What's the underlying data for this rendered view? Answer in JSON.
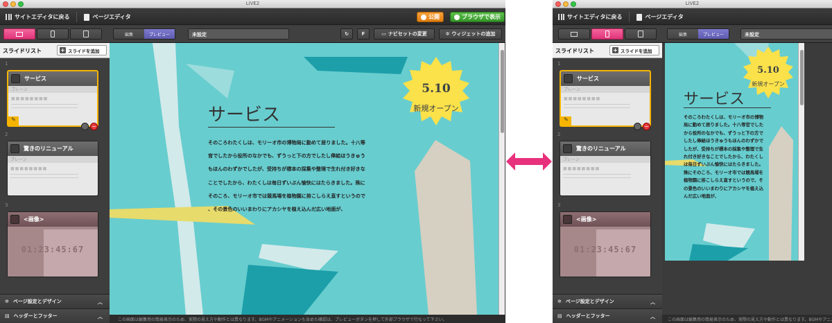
{
  "window": {
    "title": "LiVE2"
  },
  "toolbar": {
    "back_label": "サイトエディタに戻る",
    "page_editor_label": "ページエディタ",
    "publish_label": "公開",
    "browser_label": "ブラウザで表示",
    "mode_edit": "編集",
    "mode_preview": "プレビュー",
    "status_field": "未設定",
    "f_label": "F",
    "navset_label": "ナビセットの変更",
    "widget_label": "ウィジェットの追加"
  },
  "sidebar": {
    "title": "スライドリスト",
    "add_label": "スライドを追加",
    "slides": [
      {
        "num": "1",
        "title": "サービス",
        "layout": "プレーン",
        "placeholder": "■■■■■■■■"
      },
      {
        "num": "2",
        "title": "驚きのリニューアル",
        "layout": "プレーン",
        "placeholder": "■■■■■■■■"
      },
      {
        "num": "3",
        "title": "<画像>",
        "timer": "01:23:45:67"
      }
    ],
    "footer_design": "ページ設定とデザイン",
    "footer_header": "ヘッダーとフッター"
  },
  "preview": {
    "badge_date": "5.10",
    "badge_text": "新規オープン",
    "title": "サービス",
    "body": "そのころわたくしは、モリーオ市の博物局に勤めて居りました。十八等官でしたから役所のなかでも、ずうっと下の方でしたし俸給ほうきゅうもほんのわずかでしたが、受持ちが標本の採集や整理で生れ付き好きなことでしたから、わたくしは毎日ずいぶん愉快にはたらきました。殊にそのころ、モリーオ市では競馬場を植物園に拵こしらえ直すというので、その景色のいいまわりにアカシヤを植え込んだ広い地面が、",
    "body_lines_desktop": [
      "そのころわたくしは、モリーオ市の博物局に勤めて居りました。十八等",
      "官でしたから役所のなかでも、ずうっと下の方でしたし俸給ほうきゅう",
      "もほんのわずかでしたが、受持ちが標本の採集や整理で生れ付き好きな",
      "ことでしたから、わたくしは毎日ずいぶん愉快にはたらきました。殊に",
      "そのころ、モリーオ市では競馬場を植物園に拵こしらえ直すというので",
      "、その景色のいいまわりにアカシヤを植え込んだ広い地面が、"
    ],
    "body_lines_mobile": [
      "そのころわたくしは、モリーオ市の博物",
      "局に勤めて居りました。十八等官でした",
      "から役所のなかでも、ずうっと下の方で",
      "したし俸給ほうきゅうもほんのわずかで",
      "したが、受持ちが標本の採集や整理で生",
      "れ付き好きなことでしたから、わたくし",
      "は毎日ずいぶん愉快にはたらきました。",
      "殊にそのころ、モリーオ市では競馬場を",
      "植物園に拵こしらえ直すというので、そ",
      "の景色のいいまわりにアカシヤを植え込",
      "んだ広い地面が、"
    ]
  },
  "status": {
    "notice": "この画面は編集用の簡易表示のため、実際の見え方や動作とは異なります。BGMやアニメーションも含めた確認は、プレビューボタンを押して外部ブラウザで行なって下さい。"
  },
  "colors": {
    "accent_pink": "#e03479",
    "preview_bg": "#68cdcf",
    "badge_yellow": "#fbe14a",
    "publish_orange": "#f7a23a",
    "browser_green": "#47ad38"
  }
}
